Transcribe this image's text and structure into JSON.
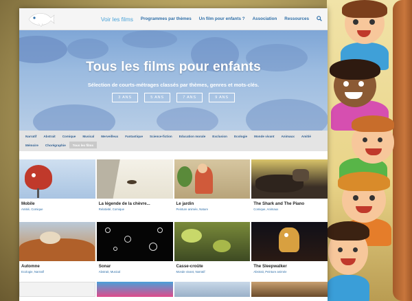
{
  "nav": {
    "logo_alt": "fish-logo",
    "items": [
      {
        "label": "Voir les films",
        "active": true
      },
      {
        "label": "Programmes par thèmes",
        "active": false
      },
      {
        "label": "Un film pour enfants ?",
        "active": false
      },
      {
        "label": "Association",
        "active": false
      },
      {
        "label": "Ressources",
        "active": false
      }
    ],
    "search_icon": "search-icon"
  },
  "hero": {
    "title": "Tous les films pour enfants",
    "subtitle": "Sélection de courts-métrages classés par thèmes, genres et mots-clés.",
    "ages": [
      "3 ANS",
      "5 ANS",
      "7 ANS",
      "9 ANS"
    ]
  },
  "tags": [
    {
      "label": "Narratif"
    },
    {
      "label": "Abstrait"
    },
    {
      "label": "Comique"
    },
    {
      "label": "Musical"
    },
    {
      "label": "Merveilleux"
    },
    {
      "label": "Fantastique"
    },
    {
      "label": "Science-fiction"
    },
    {
      "label": "Education morale"
    },
    {
      "label": "Exclusion"
    },
    {
      "label": "Ecologie"
    },
    {
      "label": "Monde vivant"
    },
    {
      "label": "Animaux"
    },
    {
      "label": "Amitié"
    },
    {
      "label": "Mémoire"
    },
    {
      "label": "Chorégraphie"
    },
    {
      "label": "Tous les films",
      "selected": true
    }
  ],
  "films_row1": [
    {
      "title": "Mobile",
      "tags": "Amitié, Comique"
    },
    {
      "title": "La légende de la chèvre...",
      "tags": "Relativité, Comique"
    },
    {
      "title": "Le jardin",
      "tags": "Peinture animée, Nature"
    },
    {
      "title": "The Shark and The Piano",
      "tags": "Comique, Animaux"
    }
  ],
  "films_row2": [
    {
      "title": "Automne",
      "tags": "Ecologie, Narratif"
    },
    {
      "title": "Sonar",
      "tags": "Abstrait, Musical"
    },
    {
      "title": "Casse-croûte",
      "tags": "Monde vivant, Narratif"
    },
    {
      "title": "The Sleepwalker",
      "tags": "Abstrait, Peinture animée"
    }
  ],
  "colors": {
    "link": "#2f6fa8",
    "active_nav": "#4aa3d8",
    "hero_sky": "#9bbbe0",
    "tag_bar": "#e4e4e4"
  }
}
